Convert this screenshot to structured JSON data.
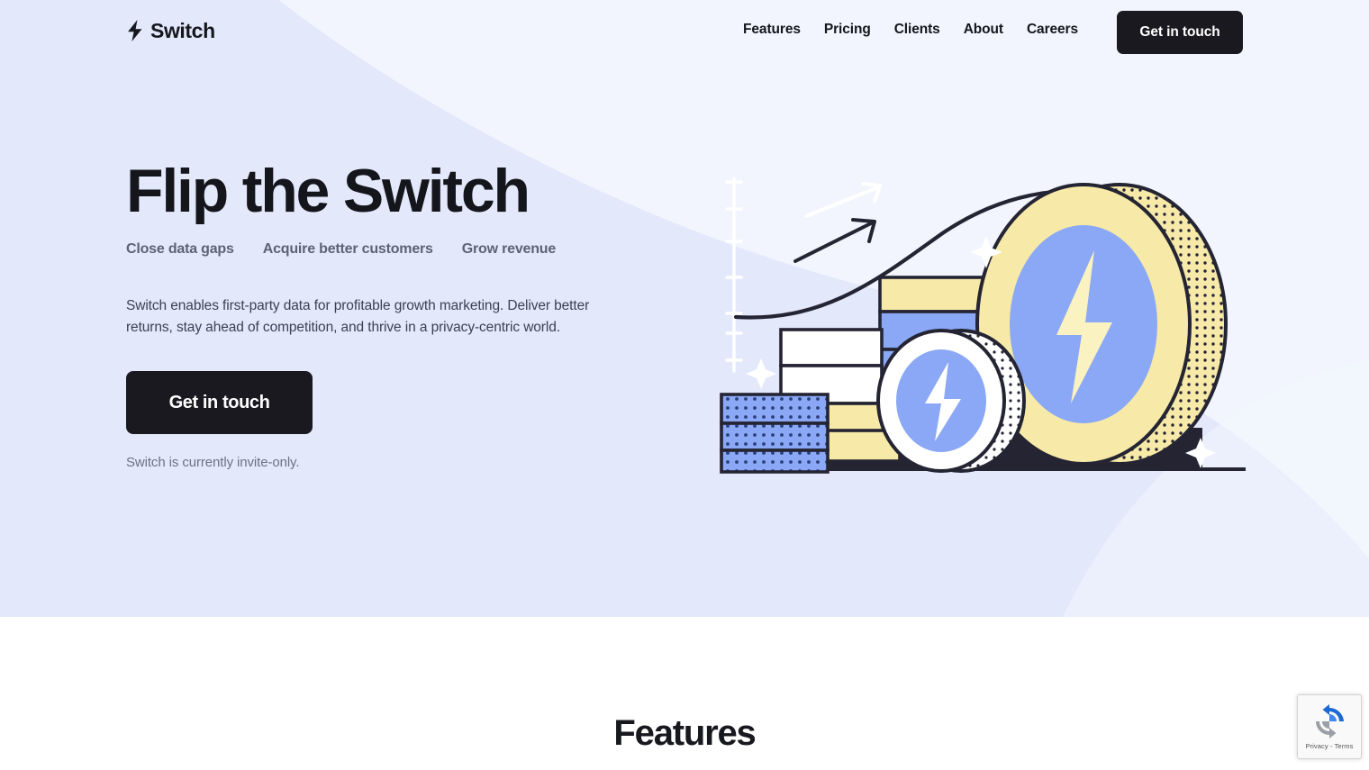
{
  "brand": {
    "name": "Switch",
    "logo_icon": "lightning-bolt-icon"
  },
  "nav": {
    "links": [
      {
        "label": "Features"
      },
      {
        "label": "Pricing"
      },
      {
        "label": "Clients"
      },
      {
        "label": "About"
      },
      {
        "label": "Careers"
      }
    ],
    "cta_label": "Get in touch"
  },
  "hero": {
    "title": "Flip the Switch",
    "taglines": [
      "Close data gaps",
      "Acquire better customers",
      "Grow revenue"
    ],
    "paragraph": "Switch enables first-party data for profitable growth marketing. Deliver better returns, stay ahead of competition, and thrive in a privacy-centric world.",
    "cta_label": "Get in touch",
    "note": "Switch is currently invite-only.",
    "illustration_alt": "coins-and-growth-chart-illustration"
  },
  "features_section": {
    "title": "Features"
  },
  "recaptcha": {
    "label": "Privacy - Terms",
    "icon": "recaptcha-icon"
  },
  "colors": {
    "hero_background": "#e3e9fb",
    "hero_background_light": "#f2f5fd",
    "wave_shade": "#ccd7f5",
    "dark": "#19191f",
    "coin_yellow": "#f7eaa8",
    "coin_blue": "#8aa8f5",
    "outline": "#242433",
    "white": "#ffffff",
    "muted_text": "#5d6373"
  }
}
